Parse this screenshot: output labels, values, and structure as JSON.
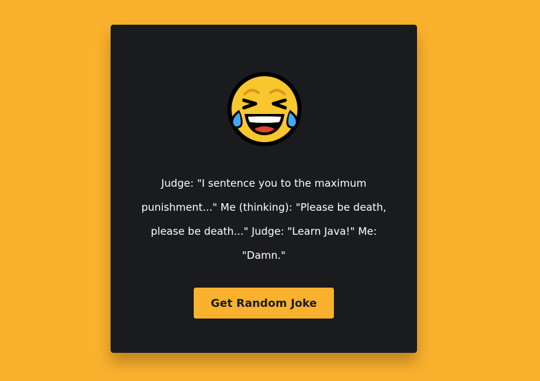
{
  "colors": {
    "background": "#fab12e",
    "card": "#1a1b1e",
    "text": "#ffffff",
    "button": "#fab12e",
    "button_text": "#1a1b1e"
  },
  "emoji": {
    "icon": "face-with-tears-of-joy-icon"
  },
  "joke": {
    "text": "Judge: \"I sentence you to the maximum punishment...\" Me (thinking): \"Please be death, please be death...\" Judge: \"Learn Java!\" Me: \"Damn.\""
  },
  "button": {
    "label": "Get Random Joke"
  }
}
